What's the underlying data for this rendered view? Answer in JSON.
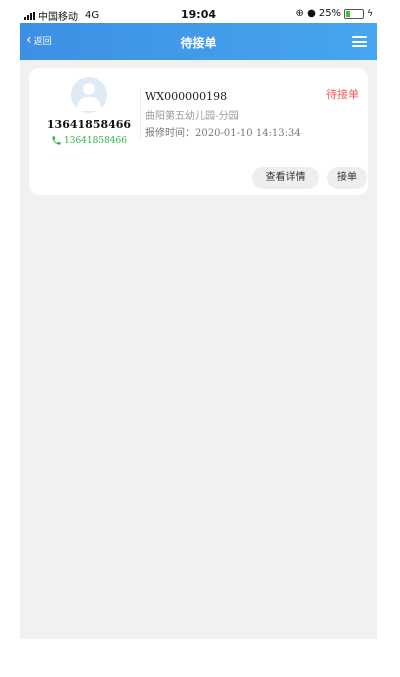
{
  "status_bar": {
    "carrier": "中国移动",
    "network": "4G",
    "time": "19:04",
    "icons": "⊕ ●",
    "battery_percent": "25%",
    "battery_level": 0.25,
    "battery_color": "#3cc13c"
  },
  "nav": {
    "back_label": "返回",
    "title": "待接单",
    "menu_icon": "hamburger-menu-icon",
    "color": "#3d8fe3"
  },
  "order": {
    "customer_phone": "13641858466",
    "call_phone": "13641858466",
    "id": "WX000000198",
    "location": "曲阳第五幼儿园-分园",
    "time_label": "报修时间：",
    "time_value": "2020-01-10 14:13:34",
    "status": "待接单",
    "status_color": "#ef5a52",
    "call_color": "#2fb14b",
    "detail_button": "查看详情",
    "accept_button": "接单"
  }
}
